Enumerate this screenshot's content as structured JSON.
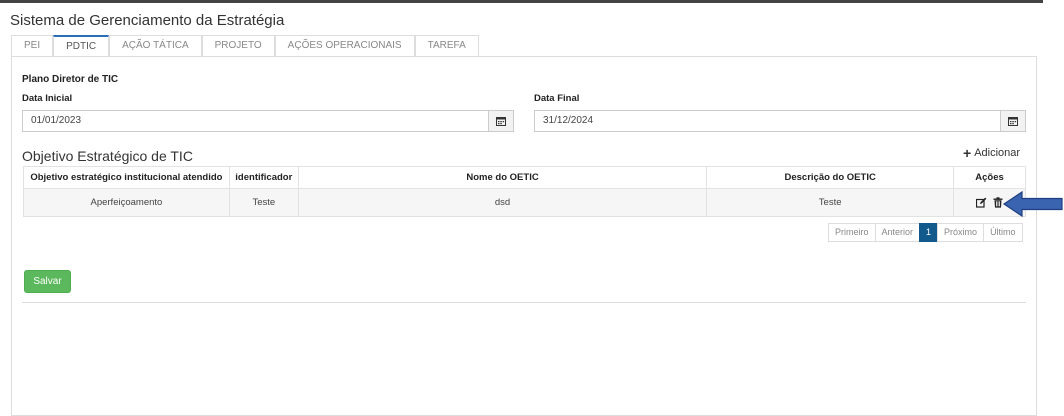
{
  "app": {
    "title": "Sistema de Gerenciamento da Estratégia"
  },
  "tabs": [
    "PEI",
    "PDTIC",
    "AÇÃO TÁTICA",
    "PROJETO",
    "AÇÕES OPERACIONAIS",
    "TAREFA"
  ],
  "active_tab": "PDTIC",
  "plan": {
    "title": "Plano Diretor de TIC",
    "start_label": "Data Inicial",
    "start_value": "01/01/2023",
    "end_label": "Data Final",
    "end_value": "31/12/2024"
  },
  "objectives": {
    "title": "Objetivo Estratégico de TIC",
    "add_label": "Adicionar",
    "columns": [
      "Objetivo estratégico institucional atendido",
      "identificador",
      "Nome do OETIC",
      "Descrição do OETIC",
      "Ações"
    ],
    "rows": [
      {
        "objective": "Aperfeiçoamento",
        "identifier": "Teste",
        "name": "dsd",
        "description": "Teste"
      }
    ]
  },
  "pagination": {
    "first": "Primeiro",
    "prev": "Anterior",
    "current": "1",
    "next": "Próximo",
    "last": "Último"
  },
  "save_label": "Salvar",
  "colors": {
    "accent": "#125a8c",
    "save": "#5cb85c",
    "arrow": "#3a63b0"
  }
}
